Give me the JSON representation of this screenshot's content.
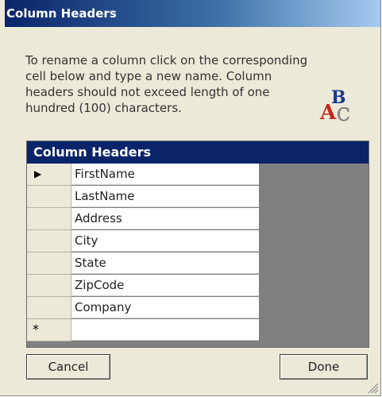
{
  "window": {
    "title": "Column Headers"
  },
  "instructions": {
    "line1": "To rename a column click on the corresponding",
    "line2": "cell below and type a new name. Column",
    "line3": "headers should not exceed length of one",
    "line4": "hundred (100) characters."
  },
  "icon": {
    "name": "abc-rename-icon",
    "letters": [
      "A",
      "B",
      "C"
    ],
    "colors": {
      "A": "#c0281c",
      "B": "#1a3a8c",
      "C": "#9a9a9a"
    }
  },
  "grid": {
    "caption": "Column Headers",
    "current_row_marker": "▶",
    "new_row_marker": "*",
    "rows": [
      {
        "value": "FirstName"
      },
      {
        "value": "LastName"
      },
      {
        "value": "Address"
      },
      {
        "value": "City"
      },
      {
        "value": "State"
      },
      {
        "value": "ZipCode"
      },
      {
        "value": "Company"
      }
    ],
    "colors": {
      "caption_bg": "#0a246a",
      "empty_area": "#808080"
    }
  },
  "buttons": {
    "cancel": "Cancel",
    "done": "Done"
  }
}
